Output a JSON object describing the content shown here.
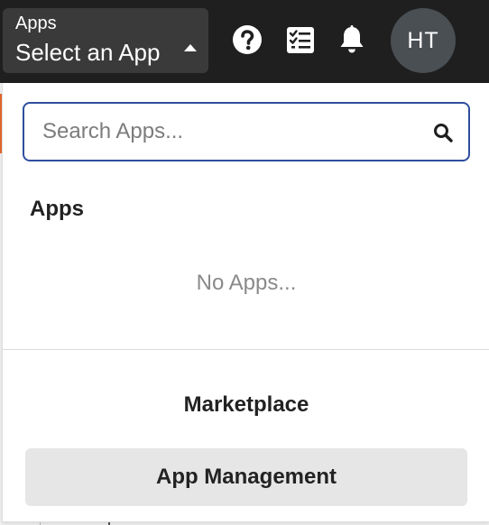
{
  "topbar": {
    "app_selector": {
      "caption": "Apps",
      "value": "Select an App"
    },
    "icons": [
      "help-icon",
      "task-list-icon",
      "bell-icon"
    ],
    "avatar_initials": "HT",
    "colors": {
      "background": "#1f1f1f",
      "selector_background": "#3a3a3a",
      "avatar_background": "#4a4f54"
    }
  },
  "dropdown": {
    "search": {
      "placeholder": "Search Apps...",
      "value": ""
    },
    "apps_heading": "Apps",
    "empty_message": "No Apps...",
    "marketplace_label": "Marketplace",
    "app_management_label": "App Management",
    "colors": {
      "search_border": "#2f4f9e",
      "button_background": "#e6e6e6"
    }
  },
  "background": {
    "accent_color": "#e8692d"
  }
}
